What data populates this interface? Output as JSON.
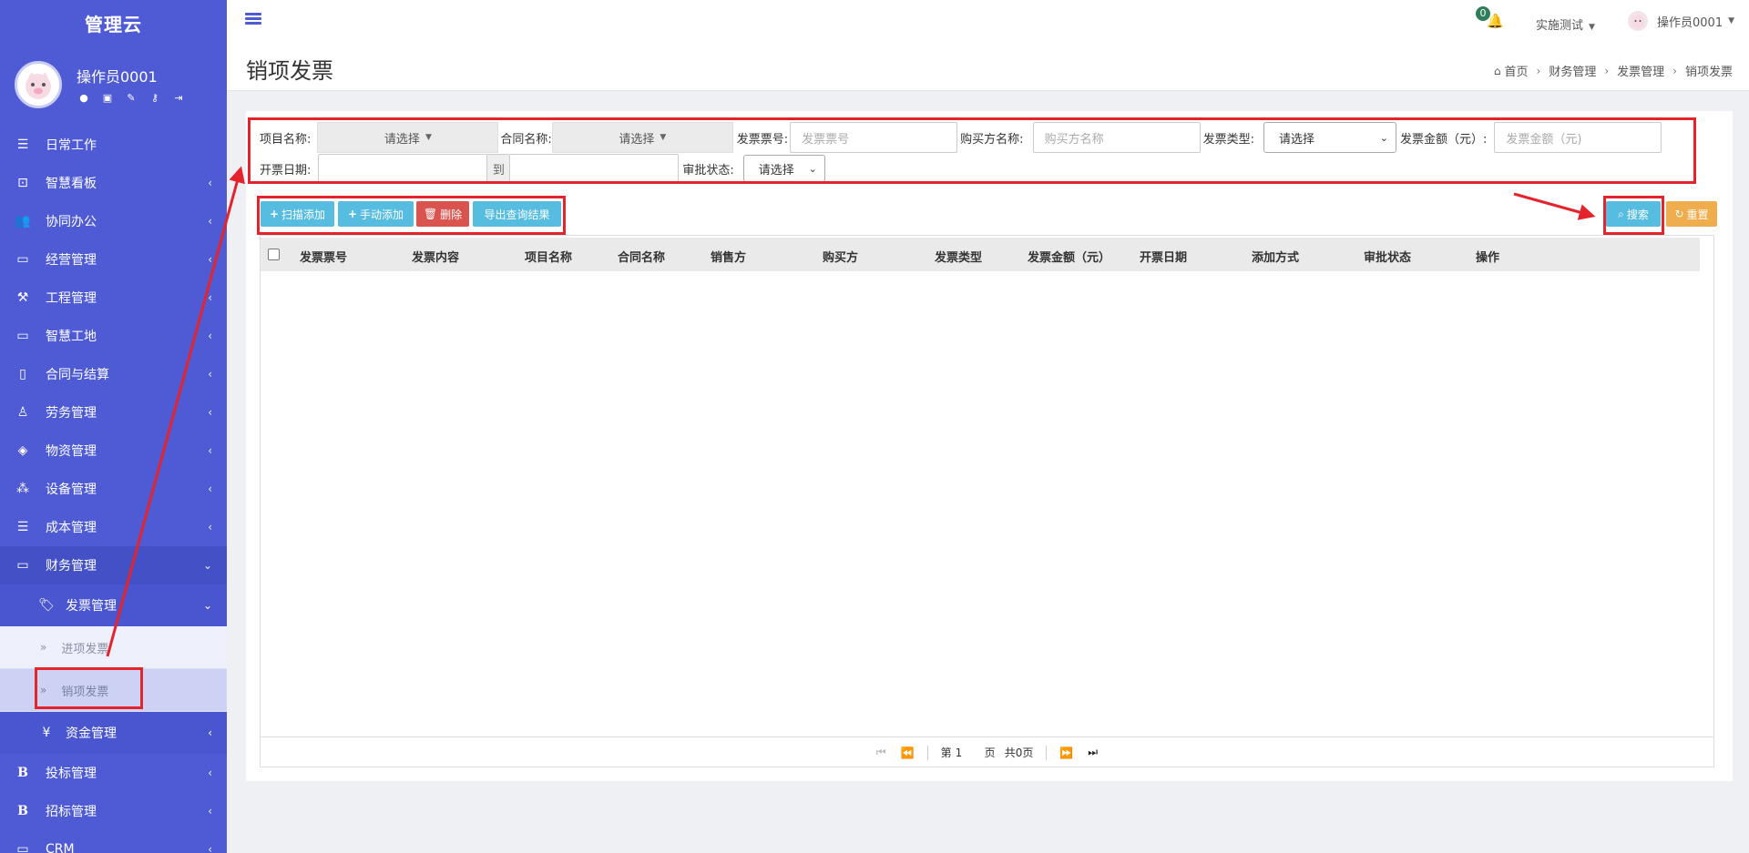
{
  "sidebar": {
    "brand": "管理云",
    "user_name": "操作员0001",
    "user_actions": [
      "user-icon",
      "id-card-icon",
      "edit-icon",
      "key-icon",
      "logout-icon"
    ],
    "items": [
      {
        "label": "日常工作",
        "icon": "list-icon",
        "chevron": ""
      },
      {
        "label": "智慧看板",
        "icon": "dashboard-icon",
        "chevron": "‹"
      },
      {
        "label": "协同办公",
        "icon": "users-icon",
        "chevron": "‹"
      },
      {
        "label": "经营管理",
        "icon": "monitor-icon",
        "chevron": "‹"
      },
      {
        "label": "工程管理",
        "icon": "gavel-icon",
        "chevron": "‹"
      },
      {
        "label": "智慧工地",
        "icon": "monitor-icon",
        "chevron": "‹"
      },
      {
        "label": "合同与结算",
        "icon": "file-icon",
        "chevron": "‹"
      },
      {
        "label": "劳务管理",
        "icon": "worker-icon",
        "chevron": "‹"
      },
      {
        "label": "物资管理",
        "icon": "cube-icon",
        "chevron": "‹"
      },
      {
        "label": "设备管理",
        "icon": "cubes-icon",
        "chevron": "‹"
      },
      {
        "label": "成本管理",
        "icon": "list-icon",
        "chevron": "‹"
      },
      {
        "label": "财务管理",
        "icon": "monitor-icon",
        "chevron": "⌄"
      }
    ],
    "sub_invoice": {
      "label": "发票管理",
      "icon": "tags-icon",
      "chevron": "⌄"
    },
    "leaves": [
      {
        "label": "进项发票"
      },
      {
        "label": "销项发票"
      }
    ],
    "sub_fund": {
      "label": "资金管理",
      "icon_glyph": "¥",
      "chevron": "‹"
    },
    "bottom_items": [
      {
        "label": "投标管理",
        "glyph": "B",
        "chevron": "‹"
      },
      {
        "label": "招标管理",
        "glyph": "B",
        "chevron": "‹"
      },
      {
        "label": "CRM",
        "glyph": "▭",
        "chevron": "‹"
      }
    ]
  },
  "topbar": {
    "notification_count": "0",
    "company": "实施测试",
    "user": "操作员0001"
  },
  "header": {
    "title": "销项发票",
    "breadcrumb": [
      "首页",
      "财务管理",
      "发票管理",
      "销项发票"
    ]
  },
  "filters": {
    "project_label": "项目名称:",
    "project_value": "请选择",
    "contract_label": "合同名称:",
    "contract_value": "请选择",
    "invoice_no_label": "发票票号:",
    "invoice_no_placeholder": "发票票号",
    "buyer_label": "购买方名称:",
    "buyer_placeholder": "购买方名称",
    "type_label": "发票类型:",
    "type_value": "请选择",
    "amount_label": "发票金额（元）:",
    "amount_placeholder": "发票金额（元)",
    "date_label": "开票日期:",
    "date_to": "到",
    "approval_label": "审批状态:",
    "approval_value": "请选择"
  },
  "actions": {
    "scan_add": "扫描添加",
    "manual_add": "手动添加",
    "delete": "删除",
    "export": "导出查询结果",
    "search": "搜索",
    "reset": "重置"
  },
  "table": {
    "columns": [
      "发票票号",
      "发票内容",
      "项目名称",
      "合同名称",
      "销售方",
      "购买方",
      "发票类型",
      "发票金额（元）",
      "开票日期",
      "添加方式",
      "审批状态",
      "操作"
    ]
  },
  "pager": {
    "page_prefix": "第",
    "page_value": "1",
    "page_suffix": "页",
    "total": "共0页"
  },
  "colors": {
    "sidebar": "#4f5bd5",
    "highlight": "#e4232c",
    "info": "#56bde0",
    "danger": "#d9534f",
    "warning": "#f0ad4e"
  }
}
